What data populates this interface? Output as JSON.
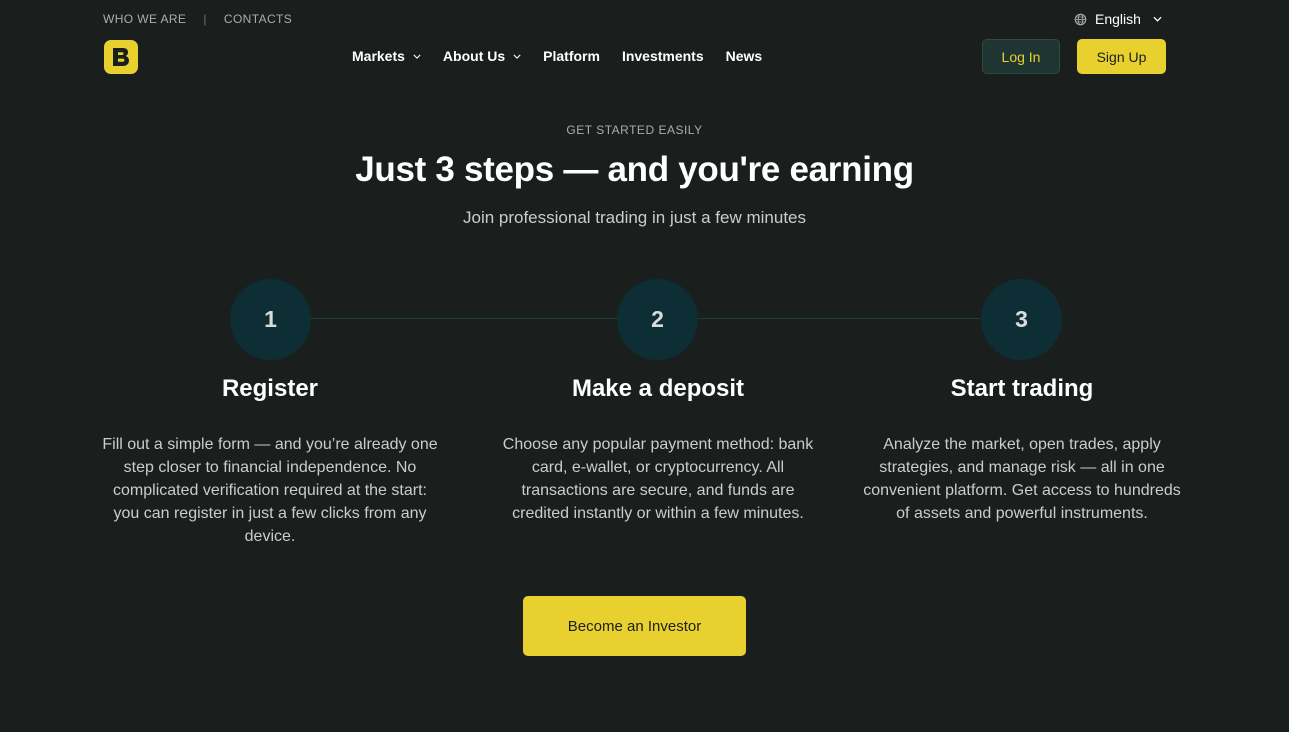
{
  "topbar": {
    "who_we_are": "WHO WE ARE",
    "separator": "|",
    "contacts": "CONTACTS"
  },
  "language": {
    "label": "English",
    "icon": "globe-icon"
  },
  "brand": {
    "logo_letter": "B",
    "accent_color": "#e8d12f",
    "background_color": "#1a1f1e"
  },
  "nav": {
    "markets": "Markets",
    "about_us": "About Us",
    "platform": "Platform",
    "investments": "Investments",
    "news": "News"
  },
  "auth": {
    "login": "Log In",
    "signup": "Sign Up"
  },
  "hero": {
    "eyebrow": "GET STARTED EASILY",
    "headline": "Just 3 steps — and you're earning",
    "subhead": "Join professional trading in just a few minutes"
  },
  "steps": [
    {
      "number": "1",
      "title": "Register",
      "text": "Fill out a simple form — and you’re already one step closer to financial independence. No complicated verification required at the start: you can register in just a few clicks from any device."
    },
    {
      "number": "2",
      "title": "Make a deposit",
      "text": "Choose any popular payment method: bank card, e-wallet, or cryptocurrency. All transactions are secure, and funds are credited instantly or within a few minutes."
    },
    {
      "number": "3",
      "title": "Start trading",
      "text": "Analyze the market, open trades, apply strategies, and manage risk — all in one convenient platform. Get access to hundreds of assets and powerful instruments."
    }
  ],
  "cta": {
    "label": "Become an Investor"
  }
}
